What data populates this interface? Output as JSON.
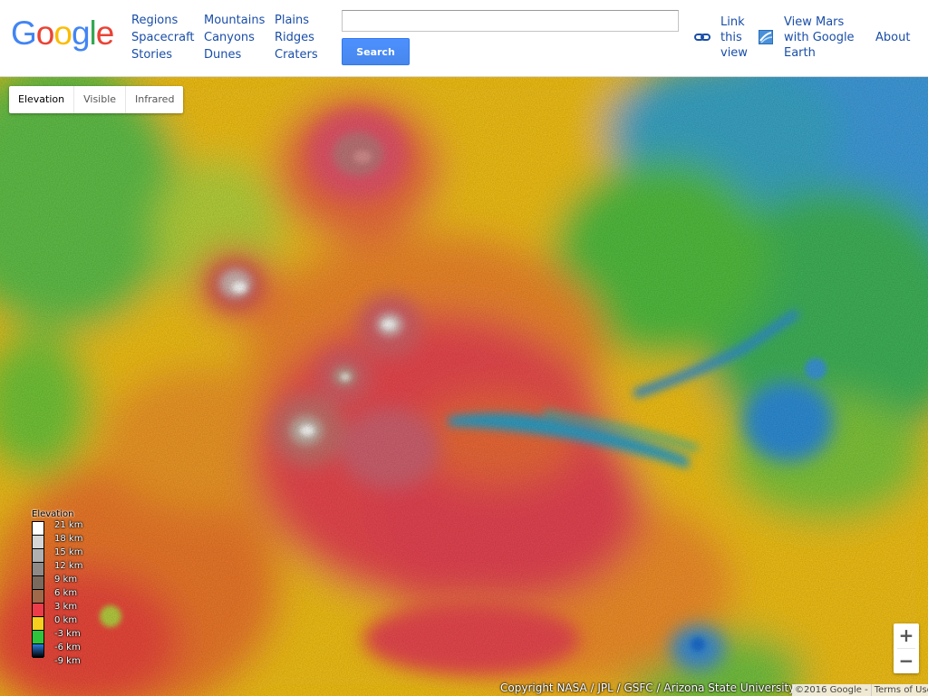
{
  "header": {
    "logo_letters": [
      {
        "char": "G",
        "color": "#4285f4"
      },
      {
        "char": "o",
        "color": "#ea4335"
      },
      {
        "char": "o",
        "color": "#fbbc05"
      },
      {
        "char": "g",
        "color": "#4285f4"
      },
      {
        "char": "l",
        "color": "#34a853"
      },
      {
        "char": "e",
        "color": "#ea4335"
      }
    ],
    "nav": {
      "col1": [
        "Regions",
        "Spacecraft",
        "Stories"
      ],
      "col2": [
        "Mountains",
        "Canyons",
        "Dunes"
      ],
      "col3": [
        "Plains",
        "Ridges",
        "Craters"
      ]
    },
    "search": {
      "value": "",
      "button_label": "Search"
    },
    "link_view": [
      "Link",
      "this",
      "view"
    ],
    "view_earth": [
      "View Mars",
      "with Google",
      "Earth"
    ],
    "about": "About"
  },
  "map": {
    "layer_tabs": [
      {
        "label": "Elevation",
        "active": true
      },
      {
        "label": "Visible",
        "active": false
      },
      {
        "label": "Infrared",
        "active": false
      }
    ],
    "legend": {
      "title": "Elevation",
      "entries": [
        {
          "label": "21 km",
          "color": "#ffffff"
        },
        {
          "label": "18 km",
          "color": "#d6d6d6"
        },
        {
          "label": "15 km",
          "color": "#b0b0b0"
        },
        {
          "label": "12 km",
          "color": "#8f8a87"
        },
        {
          "label": "9 km",
          "color": "#7a6a5e"
        },
        {
          "label": "6 km",
          "color": "#a06a4a"
        },
        {
          "label": "3 km",
          "color": "#ee3b49"
        },
        {
          "label": "0 km",
          "color": "#f7d01f"
        },
        {
          "label": "-3 km",
          "color": "#2fc33c"
        },
        {
          "label": "-6 km",
          "color": "#2a7fe0"
        },
        {
          "label": "-9 km",
          "color": "#000000"
        }
      ]
    },
    "zoom": {
      "in": "+",
      "out": "−"
    },
    "copyright": "Copyright NASA / JPL / GSFC / Arizona State University",
    "footer": {
      "google": "©2016 Google -",
      "terms": "Terms of Use"
    }
  }
}
